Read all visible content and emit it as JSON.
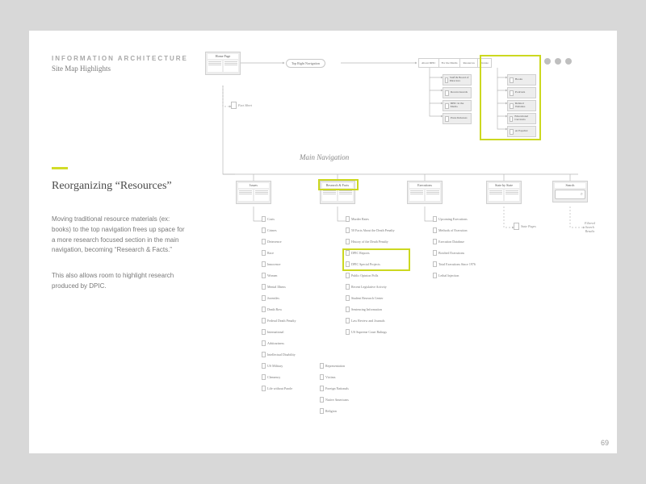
{
  "eyebrow": "INFORMATION ARCHITECTURE",
  "subtitle": "Site Map Highlights",
  "headline": "Reorganizing “Resources”",
  "body_p1": "Moving traditional resource materials (ex: books) to the top navigation frees up space for a more research focused section in the main navigation, becoming “Research & Facts.”",
  "body_p2": "This also allows room to highlight research produced by DPIC.",
  "page_number": "69",
  "sitemap": {
    "home_card": "Home Page",
    "top_nav_pill": "Top Right Navigation",
    "top_nav_items": [
      "About DPIC",
      "For the Media",
      "Resources",
      "Donate"
    ],
    "about_children": [
      "Staff & Board of Directors",
      "Recent Awards",
      "DPIC in the Media",
      "Press Releases"
    ],
    "resources_children": [
      "Books",
      "Podcasts",
      "Related Websites",
      "Educational Curricula",
      "en Español"
    ],
    "fact_sheet": "Fact Sheet",
    "main_nav_label": "Main Navigation",
    "main_sections": [
      "Issues",
      "Research & Facts",
      "Executions",
      "State by State",
      "Search"
    ],
    "search_aux": "State Pages",
    "search_results": "Filtered\nSearch\nResults",
    "issues_children": [
      "Costs",
      "Crimes",
      "Deterrence",
      "Race",
      "Innocence",
      "Women",
      "Mental Illness",
      "Juveniles",
      "Death Row",
      "Federal Death Penalty",
      "International",
      "Arbitrariness",
      "Intellectual Disability",
      "US Military",
      "Clemency",
      "Life without Parole"
    ],
    "issues_extra": [
      "Representation",
      "Victims",
      "Foreign Nationals",
      "Native Americans",
      "Religion"
    ],
    "research_children": [
      "Murder Rates",
      "50 Facts About the Death Penalty",
      "History of the Death Penalty",
      "DPIC Reports",
      "DPIC Special Projects",
      "Public Opinion Polls",
      "Recent Legislative Activity",
      "Student Research Center",
      "Sentencing Information",
      "Law Review and Journals",
      "US Supreme Court Rulings"
    ],
    "executions_children": [
      "Upcoming Executions",
      "Methods of Execution",
      "Execution Database",
      "Botched Executions",
      "Total Executions Since 1976",
      "Lethal Injection"
    ]
  }
}
